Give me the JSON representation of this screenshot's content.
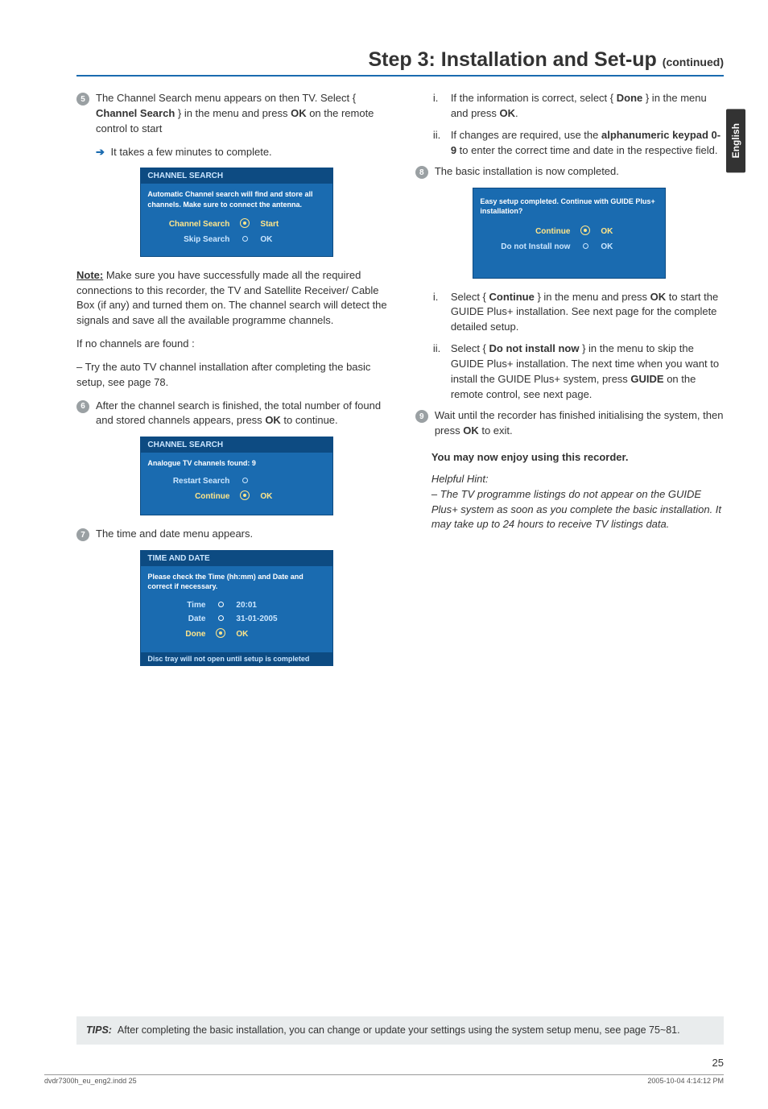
{
  "title_main": "Step 3: Installation and Set-up ",
  "title_cont": "(continued)",
  "lang_tab": "English",
  "left": {
    "step5_num": "5",
    "step5_text_a": "The Channel Search menu appears on then TV. Select { ",
    "step5_bold": "Channel Search",
    "step5_text_b": " } in the menu and press ",
    "step5_ok": "OK",
    "step5_text_c": " on the remote control to start",
    "step5_sub": " It takes a few minutes to complete.",
    "osd1_title": "CHANNEL SEARCH",
    "osd1_msg": "Automatic Channel search will find and store all channels. Make sure to connect the antenna.",
    "osd1_r1_label": "Channel Search",
    "osd1_r1_action": "Start",
    "osd1_r2_label": "Skip Search",
    "osd1_r2_action": "OK",
    "note_label": "Note:",
    "note_text": " Make sure you have successfully made all the required connections to this recorder, the TV and Satellite Receiver/ Cable Box (if any) and turned them on. The channel search will detect the signals and save all the available programme channels.",
    "nofound": "If no channels are found :",
    "nofound2": "– Try the auto TV channel installation after completing the basic setup, see page 78.",
    "step6_num": "6",
    "step6_text_a": "After the channel search is finished, the total number of found and stored channels appears, press ",
    "step6_ok": "OK",
    "step6_text_b": " to continue.",
    "osd2_title": "CHANNEL SEARCH",
    "osd2_msg": "Analogue TV channels found: 9",
    "osd2_r1_label": "Restart Search",
    "osd2_r2_label": "Continue",
    "osd2_r2_action": "OK",
    "step7_num": "7",
    "step7_text": "The time and date menu appears.",
    "osd3_title": "TIME AND DATE",
    "osd3_msg": "Please check the Time (hh:mm) and Date and correct if necessary.",
    "osd3_r1_label": "Time",
    "osd3_r1_val": "20:01",
    "osd3_r2_label": "Date",
    "osd3_r2_val": "31-01-2005",
    "osd3_r3_label": "Done",
    "osd3_r3_val": "OK",
    "osd3_foot": "Disc tray will not open until setup is completed"
  },
  "right": {
    "i1_m": "i.",
    "i1_a": "If the information is correct, select { ",
    "i1_b": "Done",
    "i1_c": " } in the menu and press ",
    "i1_ok": "OK",
    "i1_d": ".",
    "i2_m": "ii.",
    "i2_a": "If changes are required, use the ",
    "i2_b": "alphanumeric keypad 0-9",
    "i2_c": " to enter the correct time and date in the respective field.",
    "step8_num": "8",
    "step8_text": "The basic installation is now completed.",
    "osd4_msg": "Easy setup completed.  Continue with GUIDE Plus+ installation?",
    "osd4_r1_label": "Continue",
    "osd4_r1_action": "OK",
    "osd4_r2_label": "Do not Install now",
    "osd4_r2_action": "OK",
    "i3_m": "i.",
    "i3_a": "Select { ",
    "i3_b": "Continue",
    "i3_c": " } in the menu and press ",
    "i3_ok": "OK",
    "i3_d": " to start the GUIDE Plus+ installation. See next page for the complete detailed setup.",
    "i4_m": "ii.",
    "i4_a": "Select { ",
    "i4_b": "Do not install now",
    "i4_c": " } in the menu to skip the GUIDE Plus+ installation.   The next time when you want to install the GUIDE Plus+ system, press ",
    "i4_g": "GUIDE",
    "i4_d": " on the remote control, see next page.",
    "step9_num": "9",
    "step9_a": "Wait until the recorder has finished initialising the system, then press ",
    "step9_ok": "OK",
    "step9_b": " to exit.",
    "enjoy": "You may now enjoy using this recorder.",
    "hint_label": "Helpful Hint:",
    "hint_text": "– The TV programme listings do not appear on the GUIDE Plus+ system as soon as you complete the basic installation. It may take up to 24 hours to receive TV listings data."
  },
  "tips_label": "TIPS:",
  "tips_text": "After completing the basic installation, you can change or update your settings using the system setup menu, see page 75~81.",
  "pagenum": "25",
  "foot_left": "dvdr7300h_eu_eng2.indd   25",
  "foot_right": "2005-10-04   4:14:12 PM"
}
